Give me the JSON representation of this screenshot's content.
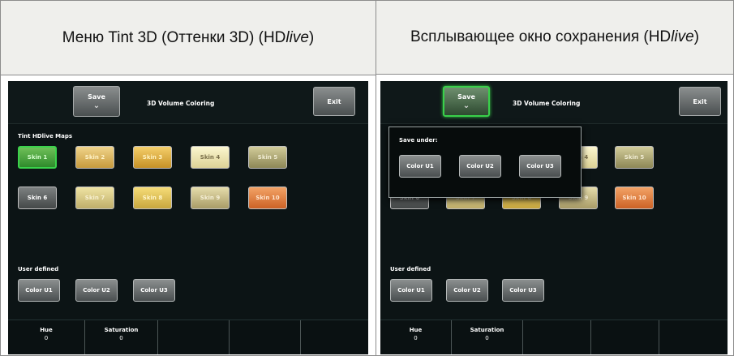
{
  "headers": {
    "left_main": "Меню Tint 3D (Оттенки 3D) (HD",
    "left_italic": "live",
    "left_close": ")",
    "right_main": "Всплывающее окно сохранения (HD",
    "right_italic": "live",
    "right_close": ")"
  },
  "screen": {
    "save_label": "Save",
    "title": "3D Volume Coloring",
    "exit_label": "Exit",
    "tint_section": "Tint HDlive Maps",
    "skins": [
      "Skin 1",
      "Skin 2",
      "Skin 3",
      "Skin 4",
      "Skin 5",
      "Skin 6",
      "Skin 7",
      "Skin 8",
      "Skin 9",
      "Skin 10"
    ],
    "user_defined": "User defined",
    "colors": [
      "Color U1",
      "Color U2",
      "Color U3"
    ],
    "hue_label": "Hue",
    "hue_value": "0",
    "saturation_label": "Saturation",
    "saturation_value": "0"
  },
  "popup": {
    "save_under": "Save under:",
    "options": [
      "Color U1",
      "Color U2",
      "Color U3"
    ]
  },
  "colors": {
    "accent_green": "#39d04a",
    "screen_bg": "#0c1415"
  }
}
